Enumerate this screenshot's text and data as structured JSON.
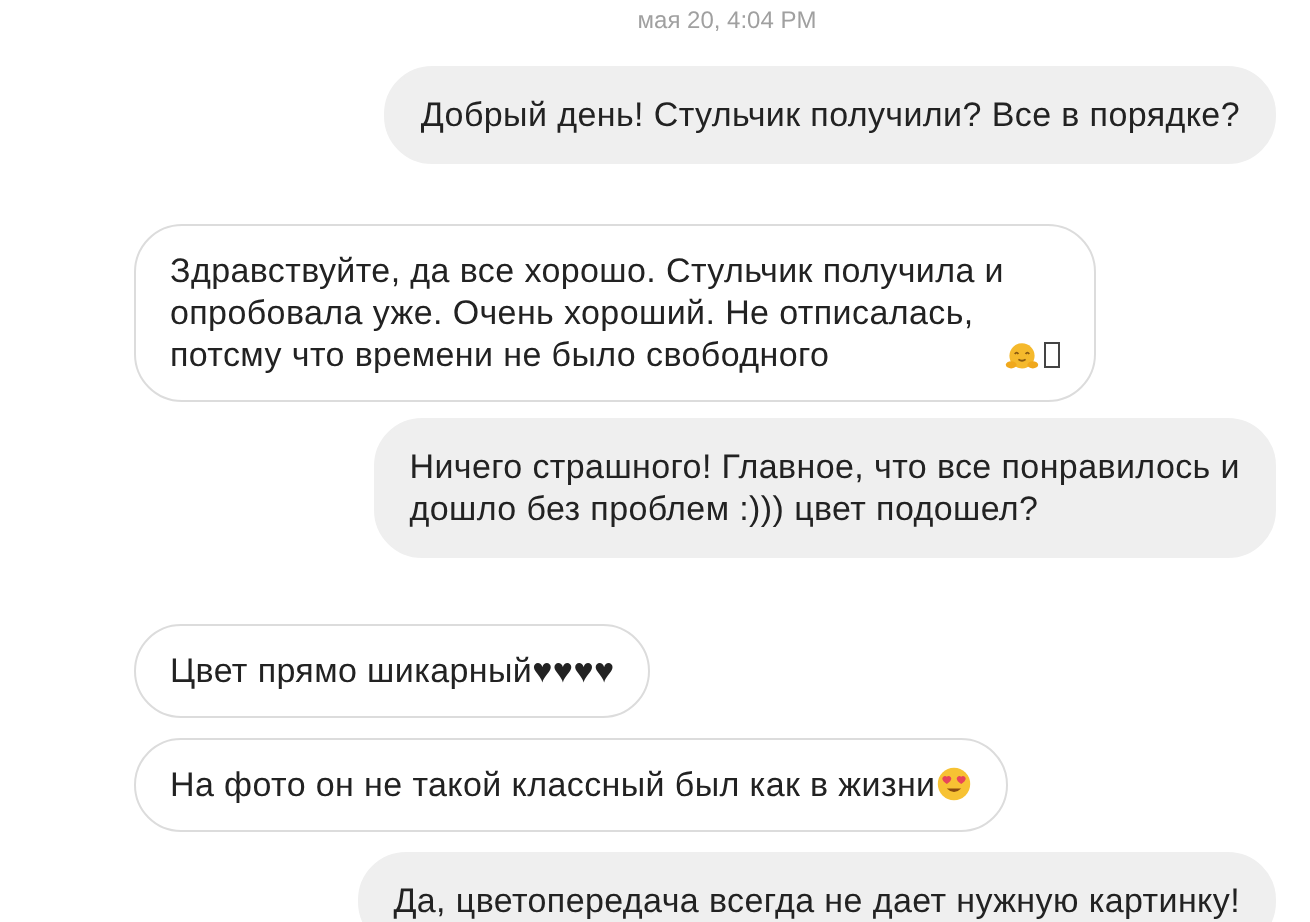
{
  "timestamp": "мая 20, 4:04 PM",
  "messages": [
    {
      "kind": "sent",
      "parts": [
        {
          "kind": "text",
          "text": "Добрый день! Стульчик получили? Все в порядке?"
        }
      ]
    },
    {
      "kind": "received",
      "parts": [
        {
          "kind": "text",
          "text": "Здравствуйте, да все хорошо. Стульчик получила и\nопробовала уже. Очень хороший. Не отписалась,\nпотсму что времени не было свободного"
        },
        {
          "kind": "hug"
        },
        {
          "kind": "missing"
        }
      ]
    },
    {
      "kind": "sent",
      "parts": [
        {
          "kind": "text",
          "text": "Ничего страшного! Главное, что все понравилось и\nдошло без проблем :))) цвет подошел?"
        }
      ]
    },
    {
      "kind": "received",
      "parts": [
        {
          "kind": "text",
          "text": "Цвет прямо шикарный♥♥♥♥"
        }
      ]
    },
    {
      "kind": "received",
      "parts": [
        {
          "kind": "text",
          "text": "На фото он не такой классный был как в жизни"
        },
        {
          "kind": "heart-eyes"
        }
      ]
    },
    {
      "kind": "sent",
      "parts": [
        {
          "kind": "text",
          "text": "Да, цветопередача всегда не дает нужную картинку!"
        }
      ]
    }
  ]
}
